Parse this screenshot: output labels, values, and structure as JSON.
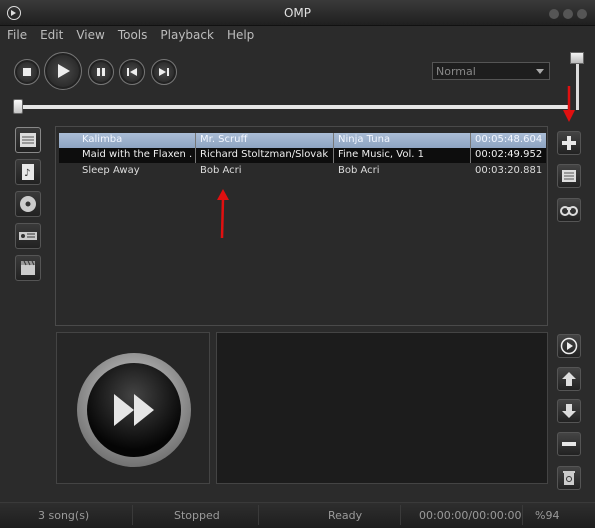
{
  "window": {
    "title": "OMP"
  },
  "menu": [
    "File",
    "Edit",
    "View",
    "Tools",
    "Playback",
    "Help"
  ],
  "mode_select": {
    "value": "Normal"
  },
  "playlist": [
    {
      "title": "Kalimba",
      "artist": "Mr. Scruff",
      "album": "Ninja Tuna",
      "duration": "00:05:48.604",
      "state": "selected"
    },
    {
      "title": "Maid with the Flaxen ...",
      "artist": "Richard Stoltzman/Slovak ...",
      "album": "Fine Music, Vol. 1",
      "duration": "00:02:49.952",
      "state": "highlighted"
    },
    {
      "title": "Sleep Away",
      "artist": "Bob Acri",
      "album": "Bob Acri",
      "duration": "00:03:20.881",
      "state": "normal"
    }
  ],
  "status": {
    "songs": "3 song(s)",
    "playback": "Stopped",
    "state": "Ready",
    "time": "00:00:00/00:00:00",
    "volume": "%94"
  },
  "colors": {
    "annotation_arrow": "#e01010",
    "selected_row": "#9bb0cc"
  }
}
